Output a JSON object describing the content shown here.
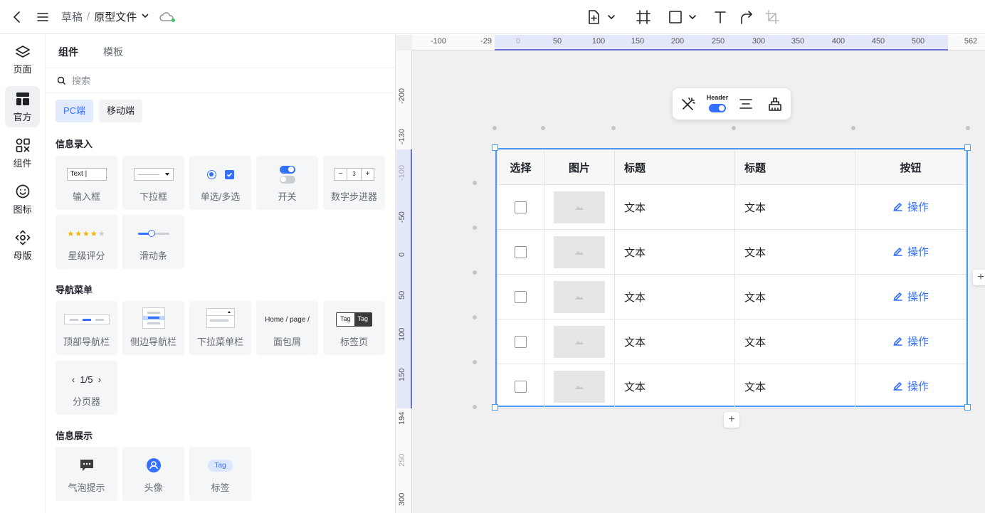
{
  "breadcrumb": {
    "draft": "草稿",
    "sep": "/",
    "file": "原型文件"
  },
  "rail": [
    {
      "label": "页面",
      "icon": "layers-icon"
    },
    {
      "label": "官方",
      "icon": "layout-icon"
    },
    {
      "label": "组件",
      "icon": "components-icon"
    },
    {
      "label": "图标",
      "icon": "smiley-icon"
    },
    {
      "label": "母版",
      "icon": "master-icon"
    }
  ],
  "panel": {
    "tabs": [
      "组件",
      "模板"
    ],
    "search_placeholder": "搜索",
    "platforms": [
      "PC端",
      "移动端"
    ],
    "sections": [
      "信息录入",
      "导航菜单",
      "信息展示"
    ],
    "input_items": [
      "输入框",
      "下拉框",
      "单选/多选",
      "开关",
      "数字步进器",
      "星级评分",
      "滑动条"
    ],
    "nav_items": [
      "顶部导航栏",
      "侧边导航栏",
      "下拉菜单栏",
      "面包屑",
      "标签页",
      "分页器"
    ],
    "display_items": [
      "气泡提示",
      "头像",
      "标签"
    ],
    "thumb_text": {
      "input": "Text |",
      "stepper_minus": "−",
      "stepper_val": "3",
      "stepper_plus": "+",
      "breadcrumb": "Home / page /",
      "tag1": "Tag",
      "tag2": "Tag",
      "pager": "‹  1/5  ›",
      "tag": "Tag"
    }
  },
  "ruler": {
    "top": [
      "-100",
      "-29",
      "0",
      "50",
      "100",
      "150",
      "200",
      "250",
      "300",
      "350",
      "400",
      "450",
      "500",
      "562"
    ],
    "left": [
      "-200",
      "-130",
      "-100",
      "-50",
      "0",
      "50",
      "100",
      "150",
      "194",
      "250",
      "300"
    ]
  },
  "floatbar": {
    "header_label": "Header"
  },
  "table": {
    "headers": [
      "选择",
      "图片",
      "标题",
      "标题",
      "按钮"
    ],
    "rows": [
      {
        "c1": "文本",
        "c2": "文本",
        "op": "操作"
      },
      {
        "c1": "文本",
        "c2": "文本",
        "op": "操作"
      },
      {
        "c1": "文本",
        "c2": "文本",
        "op": "操作"
      },
      {
        "c1": "文本",
        "c2": "文本",
        "op": "操作"
      },
      {
        "c1": "文本",
        "c2": "文本",
        "op": "操作"
      }
    ]
  },
  "canvas_add": "+",
  "colors": {
    "accent": "#3370ff",
    "selection": "#4c9bf5",
    "ruler_highlight": "#e4e8fb"
  }
}
